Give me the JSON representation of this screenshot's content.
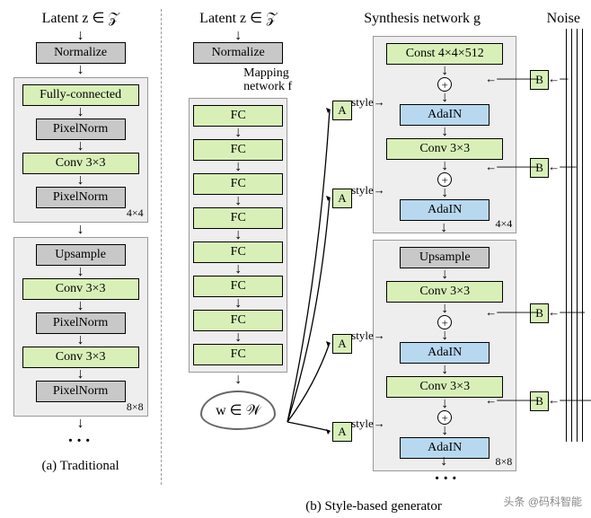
{
  "left": {
    "latent": "Latent  z ∈ 𝒵",
    "normalize": "Normalize",
    "block1": {
      "layers": [
        "Fully-connected",
        "PixelNorm",
        "Conv 3×3",
        "PixelNorm"
      ],
      "size": "4×4"
    },
    "block2": {
      "layers": [
        "Upsample",
        "Conv 3×3",
        "PixelNorm",
        "Conv 3×3",
        "PixelNorm"
      ],
      "size": "8×8"
    },
    "caption": "(a) Traditional"
  },
  "right": {
    "latent": "Latent  z ∈ 𝒵",
    "normalize": "Normalize",
    "mapping_label": "Mapping\nnetwork f",
    "fc_layers": [
      "FC",
      "FC",
      "FC",
      "FC",
      "FC",
      "FC",
      "FC",
      "FC"
    ],
    "w_cloud": "w ∈ 𝒲",
    "synth_label": "Synthesis network g",
    "noise_label": "Noise",
    "A": "A",
    "B": "B",
    "style": "style",
    "block1": {
      "const": "Const 4×4×512",
      "adain": "AdaIN",
      "conv": "Conv 3×3",
      "size": "4×4"
    },
    "block2": {
      "upsample": "Upsample",
      "conv": "Conv 3×3",
      "adain": "AdaIN",
      "size": "8×8"
    },
    "caption": "(b) Style-based generator"
  },
  "watermark": "头条 @码科智能"
}
